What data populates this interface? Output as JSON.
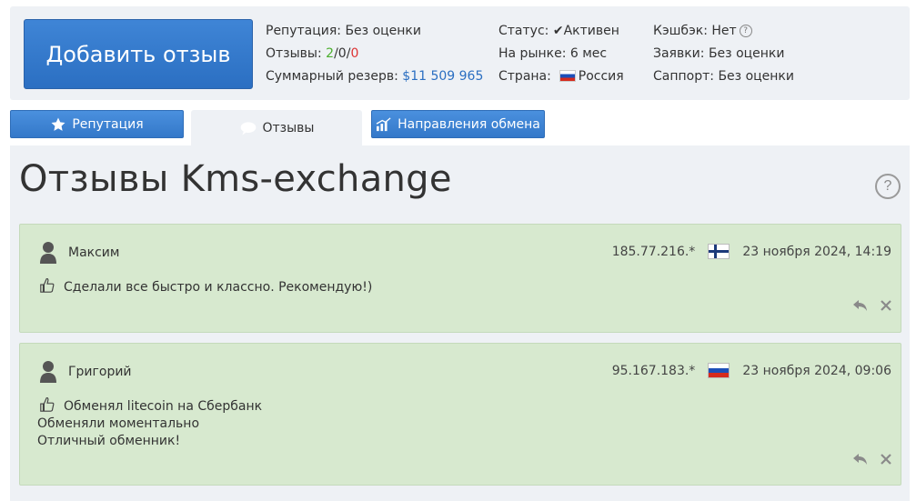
{
  "header": {
    "add_review_button": "Добавить отзыв",
    "col1": {
      "reputation_label": "Репутация:",
      "reputation_value": "Без оценки",
      "reviews_label": "Отзывы:",
      "reviews_pos": "2",
      "reviews_neu": "0",
      "reviews_neg": "0",
      "reserve_label": "Суммарный резерв:",
      "reserve_value": "$11 509 965"
    },
    "col2": {
      "status_label": "Статус:",
      "status_value": "Активен",
      "market_label": "На рынке:",
      "market_value": "6 мес",
      "country_label": "Страна:",
      "country_value": "Россия"
    },
    "col3": {
      "cashback_label": "Кэшбэк:",
      "cashback_value": "Нет",
      "requests_label": "Заявки:",
      "requests_value": "Без оценки",
      "support_label": "Саппорт:",
      "support_value": "Без оценки"
    }
  },
  "tabs": [
    {
      "label": "Репутация"
    },
    {
      "label": "Отзывы"
    },
    {
      "label": "Направления обмена"
    }
  ],
  "page_title": "Отзывы Kms-exchange",
  "reviews": [
    {
      "name": "Максим",
      "ip": "185.77.216.*",
      "country_flag": "finland",
      "date": "23 ноября 2024, 14:19",
      "lines": [
        "Сделали все быстро и классно. Рекомендую!)"
      ]
    },
    {
      "name": "Григорий",
      "ip": "95.167.183.*",
      "country_flag": "russia",
      "date": "23 ноября 2024, 09:06",
      "lines": [
        "Обменял litecoin на Сбербанк",
        "Обменяли моментально",
        "Отличный обменник!"
      ]
    }
  ],
  "colors": {
    "accent": "#2b6fc2",
    "review_bg": "#d7e9cf",
    "panel_bg": "#eef1f5"
  }
}
